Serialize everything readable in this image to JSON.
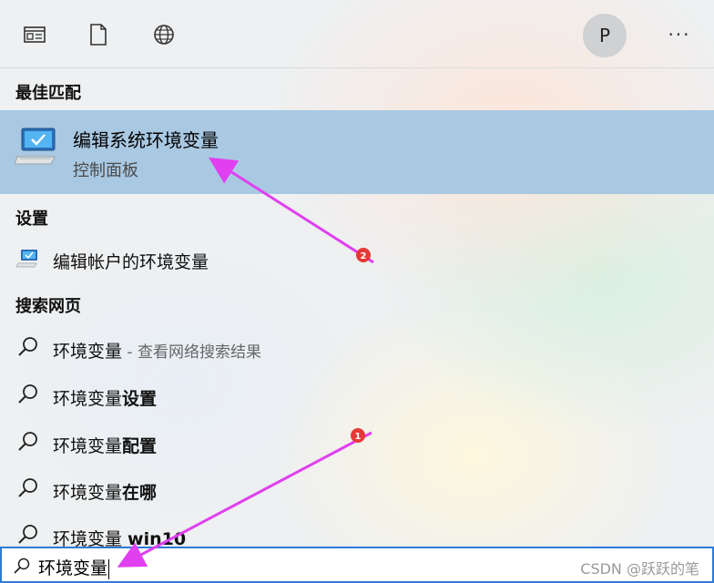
{
  "toolbar": {
    "icons": [
      "apps-icon",
      "document-icon",
      "globe-icon"
    ],
    "avatar_letter": "P",
    "more_label": "···"
  },
  "sections": {
    "best_match": "最佳匹配",
    "settings": "设置",
    "web": "搜索网页"
  },
  "best_match": {
    "title": "编辑系统环境变量",
    "subtitle": "控制面板"
  },
  "settings_items": [
    {
      "label": "编辑帐户的环境变量"
    }
  ],
  "web_items": [
    {
      "prefix": "环境变量",
      "suffix": " - 查看网络搜索结果"
    },
    {
      "prefix": "环境变量",
      "suffix": "设置"
    },
    {
      "prefix": "环境变量",
      "suffix": "配置"
    },
    {
      "prefix": "环境变量",
      "suffix": "在哪"
    },
    {
      "prefix": "环境变量 ",
      "suffix": "win10"
    }
  ],
  "search": {
    "value": "环境变量"
  },
  "watermark": "CSDN @跃跃的笔",
  "annotations": {
    "badge_1": "1",
    "badge_2": "2",
    "color": "#e040f0",
    "badge_color": "#e53935"
  },
  "colors": {
    "selected_row": "#a9c8e2",
    "search_border": "#2f7ad6"
  }
}
